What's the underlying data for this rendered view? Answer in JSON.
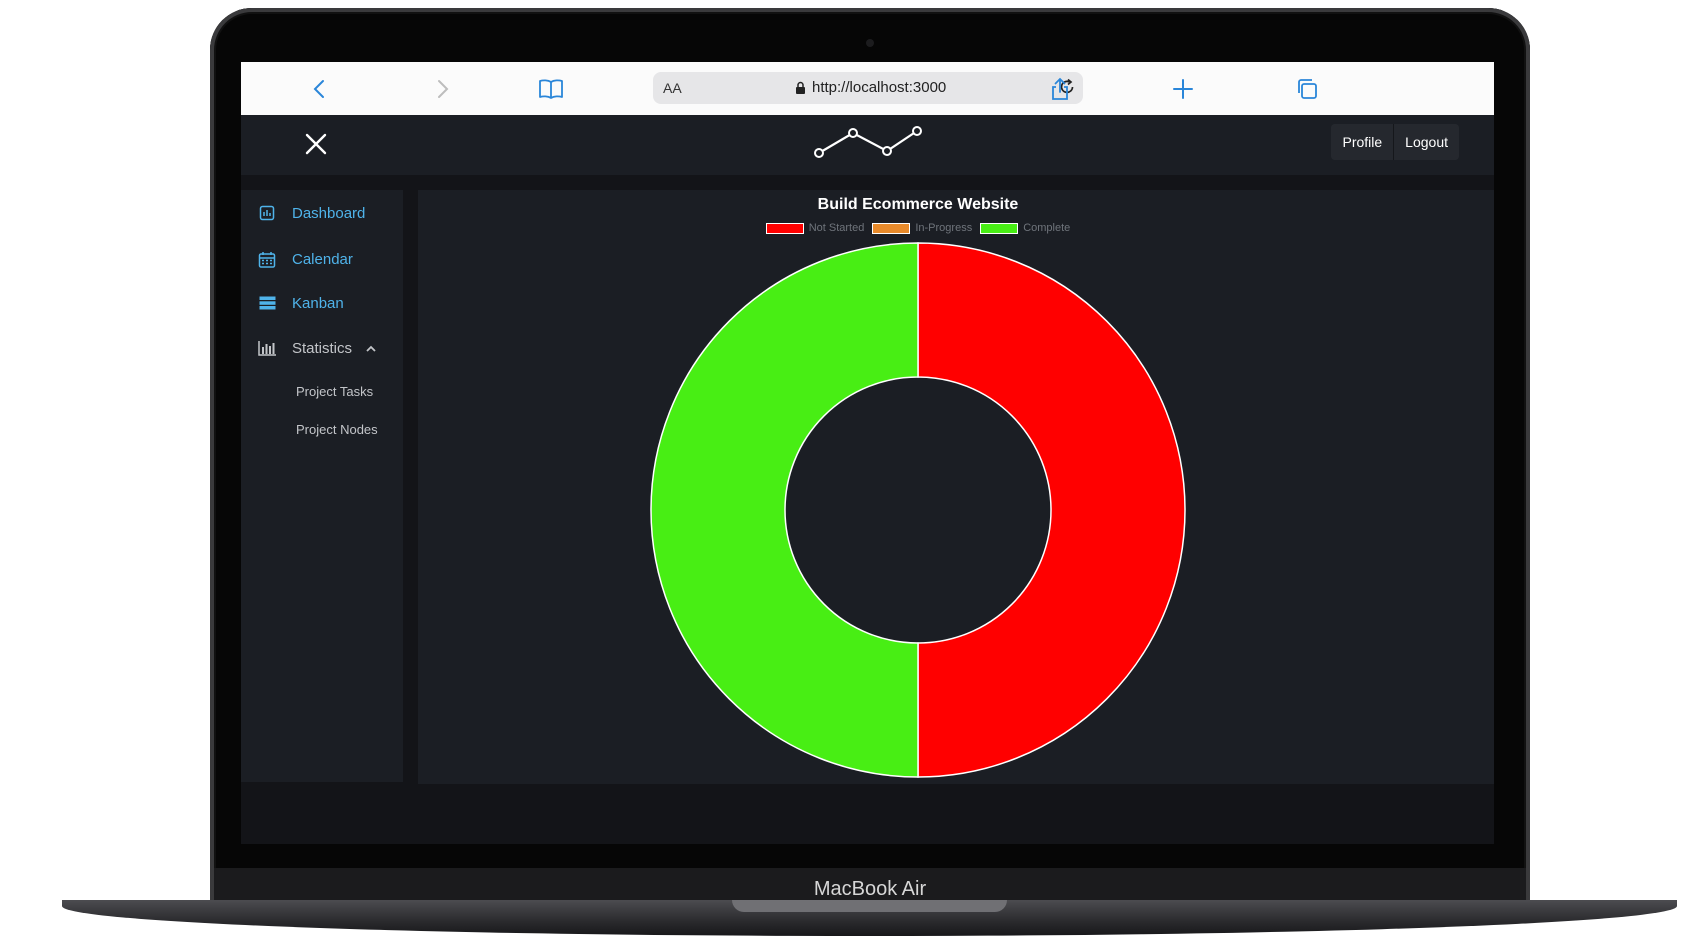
{
  "device": {
    "label": "MacBook Air"
  },
  "browser": {
    "text_size_label": "AA",
    "url": "http://localhost:3000"
  },
  "header": {
    "profile_label": "Profile",
    "logout_label": "Logout"
  },
  "sidebar": {
    "items": [
      {
        "label": "Dashboard",
        "icon": "dashboard-icon"
      },
      {
        "label": "Calendar",
        "icon": "calendar-icon"
      },
      {
        "label": "Kanban",
        "icon": "kanban-icon"
      },
      {
        "label": "Statistics",
        "icon": "bar-chart-icon",
        "expanded": true
      }
    ],
    "sub_items": [
      {
        "label": "Project Tasks"
      },
      {
        "label": "Project Nodes"
      }
    ]
  },
  "colors": {
    "accent": "#4fb3ea",
    "not_started": "#ff0000",
    "in_progress": "#e88a2a",
    "complete": "#48ee14"
  },
  "chart_data": {
    "type": "doughnut",
    "title": "Build Ecommerce Website",
    "legend_position": "top",
    "labels": [
      "Not Started",
      "In-Progress",
      "Complete"
    ],
    "values": [
      1,
      0,
      1
    ],
    "colors": [
      "#ff0000",
      "#e88a2a",
      "#48ee14"
    ]
  }
}
